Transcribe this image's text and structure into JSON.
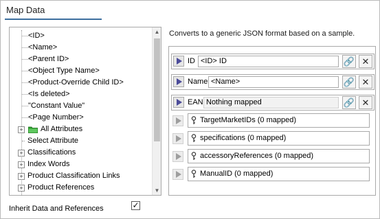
{
  "panel": {
    "title": "Map Data"
  },
  "tree": {
    "items": [
      {
        "label": "<ID>"
      },
      {
        "label": "<Name>"
      },
      {
        "label": "<Parent ID>"
      },
      {
        "label": "<Object Type Name>"
      },
      {
        "label": "<Product-Override Child ID>"
      },
      {
        "label": "<Is deleted>"
      },
      {
        "label": "\"Constant Value\""
      },
      {
        "label": "<Page Number>"
      },
      {
        "label": "All Attributes",
        "icon": "folder-icon",
        "expander": "+"
      },
      {
        "label": "Select Attribute"
      },
      {
        "label": "Classifications",
        "expander": "+"
      },
      {
        "label": "Index Words",
        "expander": "+"
      },
      {
        "label": "Product Classification Links",
        "expander": "+"
      },
      {
        "label": "Product References",
        "expander": "+"
      }
    ],
    "scroll_up": "▲",
    "scroll_down": "▼"
  },
  "mapping": {
    "description": "Converts to a generic JSON format based on a sample.",
    "fields": [
      {
        "label": "ID",
        "value": "<ID> ID",
        "link_icon": "🔗",
        "close_icon": "✕"
      },
      {
        "label": "Name",
        "value": "<Name>",
        "link_icon": "🔗",
        "close_icon": "✕"
      },
      {
        "label": "EAN",
        "value": "Nothing mapped",
        "link_icon": "🔗",
        "close_icon": "✕"
      }
    ],
    "sub_objects": [
      {
        "label": "TargetMarketIDs (0 mapped)"
      },
      {
        "label": "specifications (0 mapped)"
      },
      {
        "label": "accessoryReferences (0 mapped)"
      },
      {
        "label": "ManualID (0 mapped)"
      }
    ]
  },
  "inherit": {
    "label": "Inherit Data and References",
    "checked": true,
    "check_mark": "✓"
  },
  "colors": {
    "title_underline": "#3c6e9e",
    "arrow_active": "#4c4c9a",
    "folder": "#2e9e2e"
  }
}
